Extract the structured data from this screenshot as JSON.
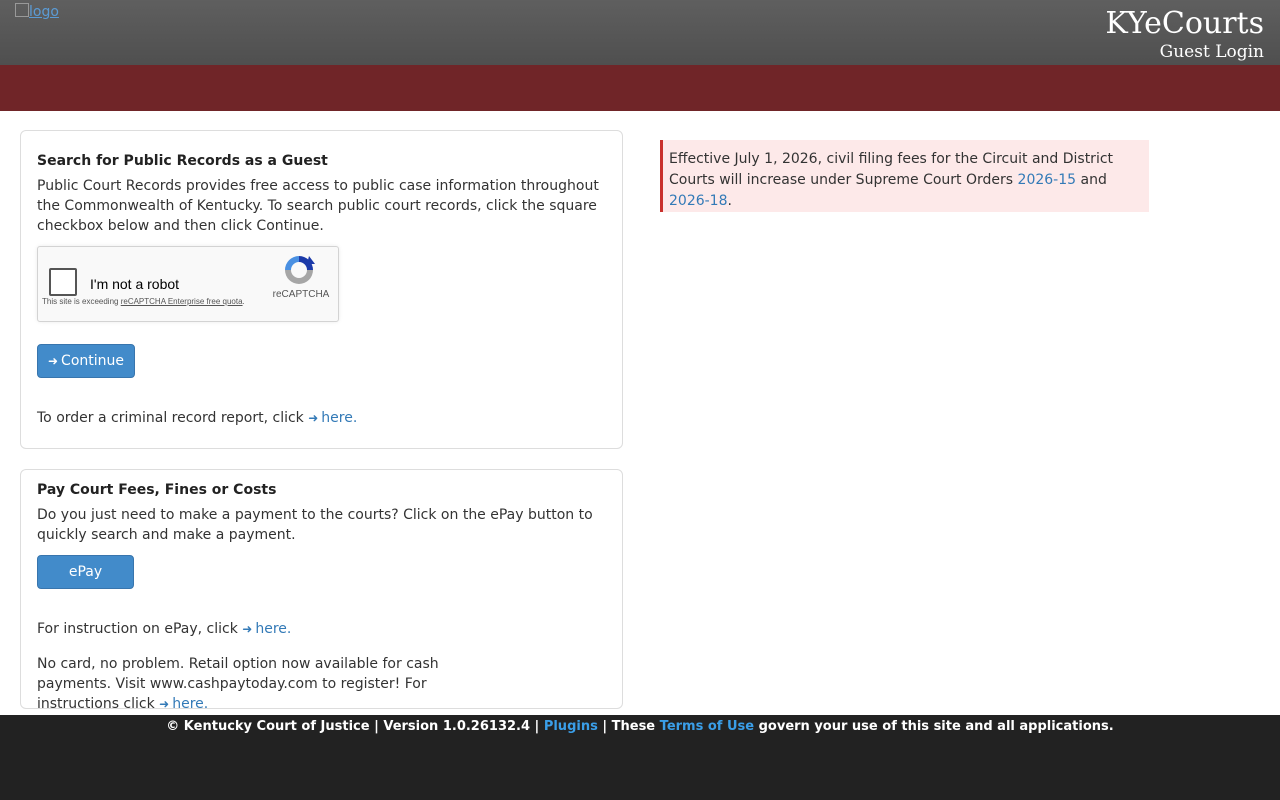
{
  "header": {
    "logo_alt": "logo",
    "brand_title": "KYeCourts",
    "brand_subtitle": "Guest Login"
  },
  "search_panel": {
    "heading": "Search for Public Records as a Guest",
    "description": "Public Court Records provides free access to public case information throughout the Commonwealth of Kentucky. To search public court records, click the square checkbox below and then click Continue.",
    "recaptcha": {
      "label": "I'm not a robot",
      "brand": "reCAPTCHA",
      "note_prefix": "This site is exceeding ",
      "note_link": "reCAPTCHA Enterprise free quota",
      "note_suffix": "."
    },
    "continue_label": "Continue",
    "order_text": "To order a criminal record report, click",
    "order_link": "here."
  },
  "pay_panel": {
    "heading": "Pay Court Fees, Fines or Costs",
    "description": "Do you just need to make a payment to the courts? Click on the ePay button to quickly search and make a payment.",
    "epay_label": "ePay",
    "instruction_text": "For instruction on ePay, click",
    "instruction_link": "here.",
    "cash_text": "No card, no problem. Retail option now available for cash payments. Visit www.cashpaytoday.com to register! For instructions click",
    "cash_link": "here."
  },
  "notice": {
    "text_before": "Effective July 1, 2026, civil filing fees for the Circuit and District Courts will increase under Supreme Court Orders",
    "link1": "2026-15",
    "middle": "and",
    "link2": "2026-18",
    "text_after": "."
  },
  "footer": {
    "copyright": "© Kentucky Court of Justice | Version 1.0.26132.4 |",
    "plugins_link": "Plugins",
    "these": "| These",
    "terms_link": "Terms of Use",
    "tail": "govern your use of this site and all applications."
  },
  "colors": {
    "header_bg": "#555555",
    "red_bar": "#702528",
    "button": "#428bca",
    "link": "#337ab7",
    "notice_bg": "#fde9e9",
    "notice_border": "#c9302c",
    "footer_bg": "#222222"
  }
}
